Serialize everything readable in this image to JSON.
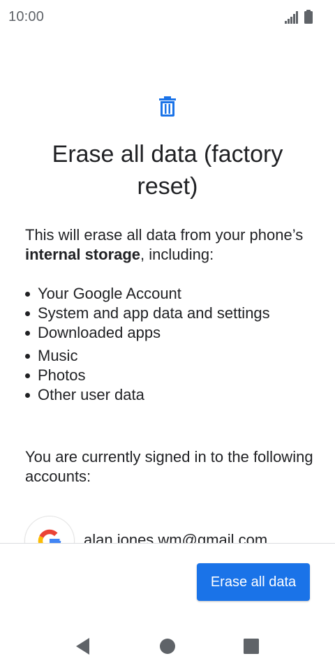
{
  "status_bar": {
    "time": "10:00",
    "icons": [
      "signal-icon",
      "battery-icon"
    ]
  },
  "page": {
    "icon": "trash-icon",
    "title": "Erase all data (factory reset)",
    "intro_prefix": "This will erase all data from your phone’s ",
    "intro_bold": "internal storage",
    "intro_suffix": ", including:",
    "items": [
      "Your Google Account",
      "System and app data and settings",
      "Downloaded apps",
      "Music",
      "Photos",
      "Other user data"
    ],
    "signed_in_text": "You are currently signed in to the following accounts:",
    "accounts": [
      {
        "icon": "google-icon",
        "email": "alan.jones.wm@gmail.com"
      }
    ]
  },
  "actions": {
    "erase_label": "Erase all data"
  },
  "nav_bar": {
    "icons": [
      "back-icon",
      "home-icon",
      "recents-icon"
    ]
  },
  "colors": {
    "accent": "#1a73e8",
    "text": "#202124",
    "status_text": "#5f6368"
  }
}
